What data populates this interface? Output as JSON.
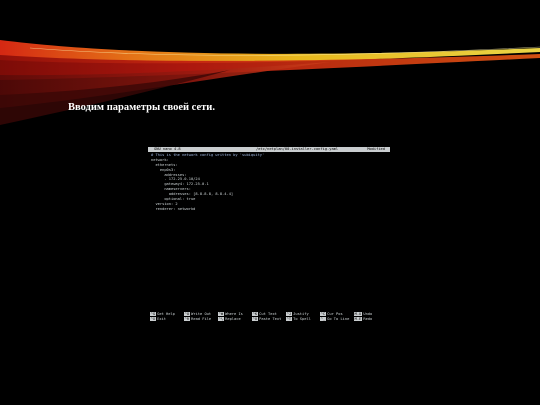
{
  "slide": {
    "title": "Вводим параметры своей сети."
  },
  "nano": {
    "header": {
      "version": "GNU nano 4.8",
      "file": "/etc/netplan/00-installer-config.yaml",
      "status": "Modified"
    },
    "lines": [
      "# This is the network config written by 'subiquity'",
      "network:",
      "  ethernets:",
      "    enp0s3:",
      "      addresses:",
      "      - 172.25.0.10/24",
      "      gateway4: 172.25.0.1",
      "      nameservers:",
      "        addresses: [8.8.8.8, 8.8.4.4]",
      "      optional: true",
      "  version: 2",
      "  renderer: networkd"
    ],
    "shortcuts_top": [
      {
        "key": "^G",
        "label": "Get Help"
      },
      {
        "key": "^O",
        "label": "Write Out"
      },
      {
        "key": "^W",
        "label": "Where Is"
      },
      {
        "key": "^K",
        "label": "Cut Text"
      },
      {
        "key": "^J",
        "label": "Justify"
      },
      {
        "key": "^C",
        "label": "Cur Pos"
      },
      {
        "key": "M-U",
        "label": "Undo"
      }
    ],
    "shortcuts_bottom": [
      {
        "key": "^X",
        "label": "Exit"
      },
      {
        "key": "^R",
        "label": "Read File"
      },
      {
        "key": "^\\",
        "label": "Replace"
      },
      {
        "key": "^U",
        "label": "Paste Text"
      },
      {
        "key": "^T",
        "label": "To Spell"
      },
      {
        "key": "^_",
        "label": "Go To Line"
      },
      {
        "key": "M-E",
        "label": "Redo"
      }
    ]
  }
}
